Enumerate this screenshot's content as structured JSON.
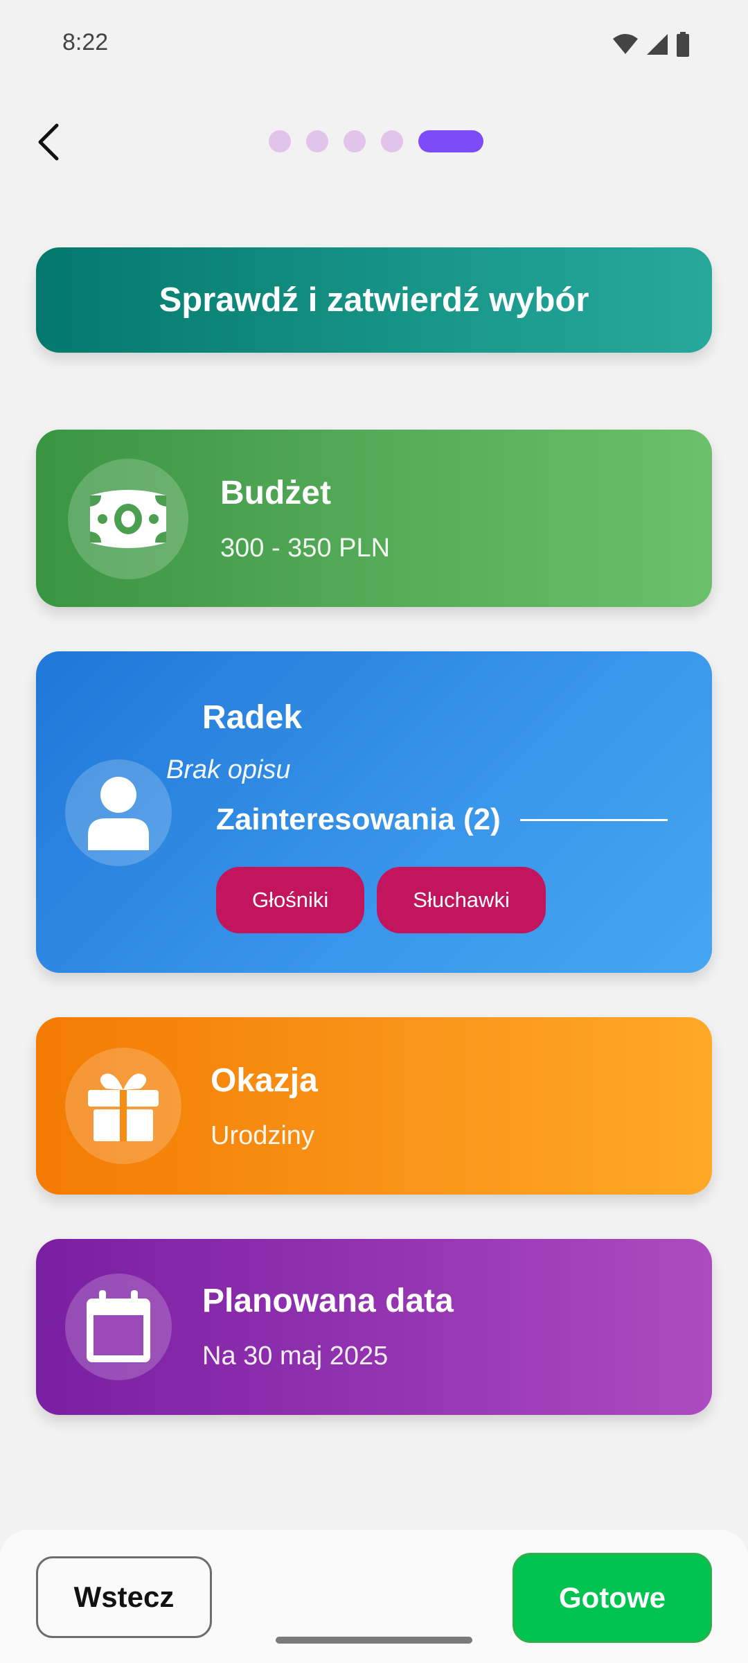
{
  "status": {
    "time": "8:22"
  },
  "progress": {
    "total_steps": 5,
    "current_step": 5
  },
  "header": {
    "title": "Sprawdź i zatwierdź wybór"
  },
  "budget": {
    "title": "Budżet",
    "value": "300 - 350 PLN",
    "icon": "money-bill-icon"
  },
  "person": {
    "name": "Radek",
    "description": "Brak opisu",
    "interests_label": "Zainteresowania (2)",
    "interests": [
      "Głośniki",
      "Słuchawki"
    ],
    "icon": "person-icon"
  },
  "occasion": {
    "title": "Okazja",
    "value": "Urodziny",
    "icon": "gift-icon"
  },
  "date": {
    "title": "Planowana data",
    "value": "Na 30 maj 2025",
    "icon": "calendar-icon"
  },
  "footer": {
    "back_label": "Wstecz",
    "done_label": "Gotowe"
  },
  "colors": {
    "accent": "#7d4bf7",
    "chip": "#c2155e",
    "done": "#00c44f"
  }
}
